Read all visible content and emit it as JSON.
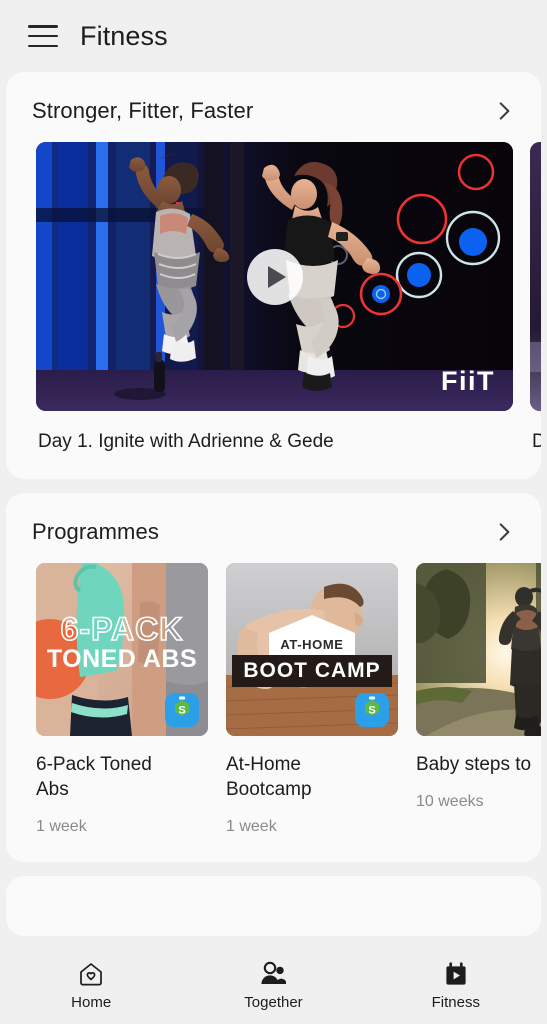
{
  "header": {
    "menu_icon": "hamburger-menu-icon",
    "title": "Fitness"
  },
  "sections": [
    {
      "id": "stronger-fitter-faster",
      "title": "Stronger, Fitter, Faster",
      "chevron_icon": "chevron-right-icon",
      "items": [
        {
          "caption": "Day 1. Ignite with Adrienne & Gede",
          "brand_logo": "FiiT",
          "play_icon": "play-icon"
        },
        {
          "caption": "D"
        }
      ]
    },
    {
      "id": "programmes",
      "title": "Programmes",
      "chevron_icon": "chevron-right-icon",
      "items": [
        {
          "overlay_line1": "6-PACK",
          "overlay_line2": "TONED ABS",
          "name": "6-Pack Toned\nAbs",
          "duration": "1 week",
          "badge_icon": "sworkit-app-badge-icon"
        },
        {
          "overlay_line1": "AT-HOME",
          "overlay_line2": "BOOT CAMP",
          "name": "At-Home\nBootcamp",
          "duration": "1 week",
          "badge_icon": "sworkit-app-badge-icon"
        },
        {
          "overlay_line1": "",
          "overlay_line2": "",
          "name": "Baby steps to",
          "duration": "10 weeks",
          "badge_icon": ""
        }
      ]
    }
  ],
  "bottom_nav": {
    "active": "Fitness",
    "items": [
      {
        "label": "Home",
        "icon": "home-heart-icon"
      },
      {
        "label": "Together",
        "icon": "people-icon"
      },
      {
        "label": "Fitness",
        "icon": "calendar-play-icon"
      }
    ]
  },
  "colors": {
    "page_background": "#f0f0f0",
    "card_background": "#fafafa",
    "text_primary": "#1d1d1d",
    "text_muted": "#8a8a8a",
    "badge_blue": "#2b9fe8",
    "badge_green": "#5bba47"
  }
}
